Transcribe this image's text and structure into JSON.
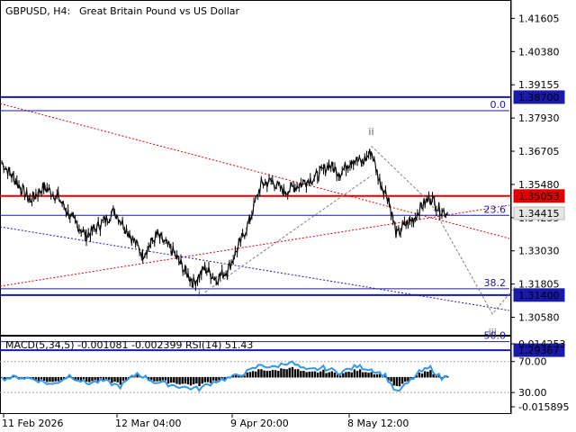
{
  "header": {
    "symbol": "GBPUSD, H4:",
    "description": "Great Britain Pound vs US Dollar"
  },
  "indicator_header": "MACD(5,34,5) -0.001081 -0.002399 RSI(14) 51.43",
  "colors": {
    "price": "#000000",
    "level": "#1a1aa8",
    "resistance": "#e00000",
    "badge_blue": "#1a1aa8",
    "badge_red": "#e00000",
    "rsi": "#3399ee",
    "fib": "#1a1aa8",
    "channel_red": "#e00000",
    "channel_blue": "#1a1aa8",
    "projection": "#808080"
  },
  "chart_data": {
    "type": "line",
    "symbol": "GBPUSD",
    "timeframe": "H4",
    "x_ticks": [
      "11 Feb 2026",
      "12 Mar 04:00",
      "9 Apr 20:00",
      "8 May 12:00"
    ],
    "y_ticks": [
      "1.41605",
      "1.40380",
      "1.39155",
      "1.37930",
      "1.36705",
      "1.35480",
      "1.34255",
      "1.33030",
      "1.31805",
      "1.30580"
    ],
    "ylim": [
      1.3,
      1.4215
    ],
    "levels": [
      {
        "value": "1.38700",
        "kind": "support-resistance",
        "color": "blue"
      },
      {
        "value": "1.35053",
        "kind": "resistance",
        "color": "red"
      },
      {
        "value": "1.31400",
        "kind": "support-resistance",
        "color": "blue"
      },
      {
        "value": "1.29367",
        "kind": "support-resistance",
        "color": "blue"
      }
    ],
    "current_price": "1.34415",
    "fibonacci": [
      {
        "label": "0.0",
        "value": 1.382
      },
      {
        "label": "23.6",
        "value": 1.3434
      },
      {
        "label": "38.2",
        "value": 1.3163
      },
      {
        "label": "50.0",
        "value": 1.2968
      }
    ],
    "wave_labels": [
      {
        "label": "i",
        "x_index": 70,
        "value": 1.3135
      },
      {
        "label": "ii",
        "x_index": 131,
        "value": 1.373
      },
      {
        "label": "iii",
        "x_index": 174,
        "value": 1.299
      }
    ],
    "price_path": [
      [
        0,
        1.363
      ],
      [
        5,
        1.356
      ],
      [
        10,
        1.349
      ],
      [
        15,
        1.354
      ],
      [
        20,
        1.35
      ],
      [
        25,
        1.342
      ],
      [
        30,
        1.336
      ],
      [
        35,
        1.34
      ],
      [
        40,
        1.345
      ],
      [
        45,
        1.337
      ],
      [
        50,
        1.329
      ],
      [
        55,
        1.336
      ],
      [
        60,
        1.331
      ],
      [
        65,
        1.323
      ],
      [
        68,
        1.3185
      ],
      [
        72,
        1.324
      ],
      [
        76,
        1.32
      ],
      [
        80,
        1.323
      ],
      [
        84,
        1.332
      ],
      [
        88,
        1.342
      ],
      [
        92,
        1.355
      ],
      [
        96,
        1.356
      ],
      [
        100,
        1.352
      ],
      [
        104,
        1.354
      ],
      [
        108,
        1.356
      ],
      [
        112,
        1.358
      ],
      [
        116,
        1.362
      ],
      [
        120,
        1.359
      ],
      [
        124,
        1.364
      ],
      [
        128,
        1.363
      ],
      [
        131,
        1.367
      ],
      [
        134,
        1.356
      ],
      [
        137,
        1.35
      ],
      [
        140,
        1.336
      ],
      [
        143,
        1.34
      ],
      [
        146,
        1.342
      ],
      [
        149,
        1.347
      ],
      [
        152,
        1.35
      ],
      [
        155,
        1.346
      ],
      [
        158,
        1.344
      ]
    ],
    "projection_path": [
      [
        131,
        1.369
      ],
      [
        152,
        1.348
      ],
      [
        174,
        1.307
      ],
      [
        182,
        1.317
      ]
    ],
    "support_path": [
      [
        72,
        1.315
      ],
      [
        131,
        1.358
      ]
    ],
    "indicator": {
      "macd_label": "MACD(5,34,5)",
      "macd_value": -0.001081,
      "signal_value": -0.002399,
      "rsi_label": "RSI(14)",
      "rsi_value": 51.43,
      "y_ticks": [
        "0.014253",
        "70.00",
        "30.00",
        "-0.015895"
      ],
      "rsi_path": [
        [
          0,
          48
        ],
        [
          6,
          50
        ],
        [
          12,
          47
        ],
        [
          18,
          40
        ],
        [
          24,
          52
        ],
        [
          30,
          42
        ],
        [
          36,
          45
        ],
        [
          42,
          38
        ],
        [
          48,
          55
        ],
        [
          54,
          44
        ],
        [
          60,
          40
        ],
        [
          66,
          36
        ],
        [
          70,
          35
        ],
        [
          76,
          45
        ],
        [
          82,
          50
        ],
        [
          88,
          58
        ],
        [
          92,
          66
        ],
        [
          96,
          62
        ],
        [
          102,
          70
        ],
        [
          108,
          58
        ],
        [
          114,
          62
        ],
        [
          120,
          56
        ],
        [
          126,
          64
        ],
        [
          131,
          60
        ],
        [
          136,
          52
        ],
        [
          140,
          30
        ],
        [
          144,
          42
        ],
        [
          148,
          56
        ],
        [
          152,
          62
        ],
        [
          156,
          48
        ],
        [
          158,
          51.43
        ]
      ]
    }
  }
}
